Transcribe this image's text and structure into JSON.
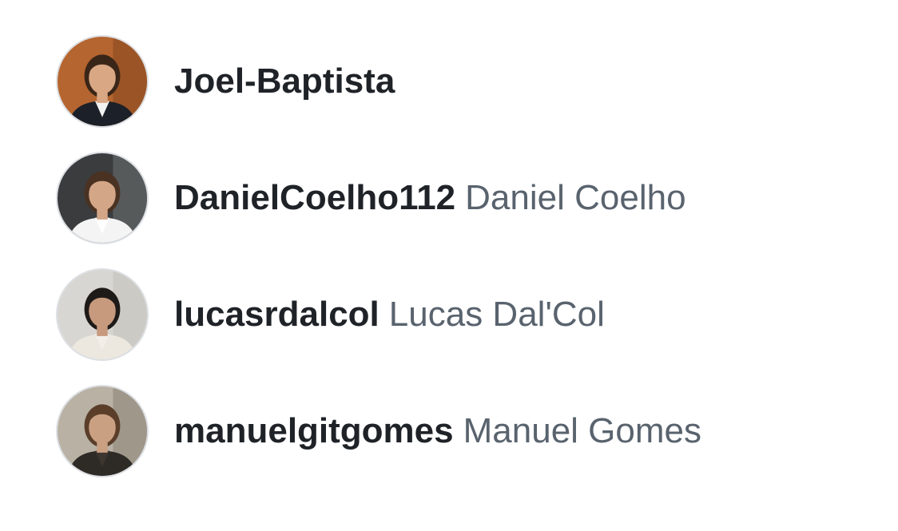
{
  "users": [
    {
      "login": "Joel-Baptista",
      "name": "",
      "avatar_icon": "avatar-joel-baptista",
      "avatar_colors": {
        "bg": "#b5652f",
        "bg2": "#8a4a22",
        "skin": "#d9a784",
        "hair": "#3a2618",
        "clothes": "#1c2028",
        "shirt": "#f2f2f2"
      }
    },
    {
      "login": "DanielCoelho112",
      "name": "Daniel Coelho",
      "avatar_icon": "avatar-danielcoelho112",
      "avatar_colors": {
        "bg": "#3a3c3e",
        "bg2": "#6b6e70",
        "skin": "#d4a688",
        "hair": "#4a3222",
        "clothes": "#f4f4f4",
        "shirt": "#ffffff"
      }
    },
    {
      "login": "lucasrdalcol",
      "name": "Lucas Dal'Col",
      "avatar_icon": "avatar-lucasrdalcol",
      "avatar_colors": {
        "bg": "#d8d6d2",
        "bg2": "#c5c2bc",
        "skin": "#c79a7e",
        "hair": "#1e1a18",
        "clothes": "#ece8e0",
        "shirt": "#f3efe8"
      }
    },
    {
      "login": "manuelgitgomes",
      "name": "Manuel Gomes",
      "avatar_icon": "avatar-manuelgitgomes",
      "avatar_colors": {
        "bg": "#b8b1a4",
        "bg2": "#8d857a",
        "skin": "#caa083",
        "hair": "#5a3e2a",
        "clothes": "#2e2a26",
        "shirt": "#3c3530"
      }
    }
  ]
}
